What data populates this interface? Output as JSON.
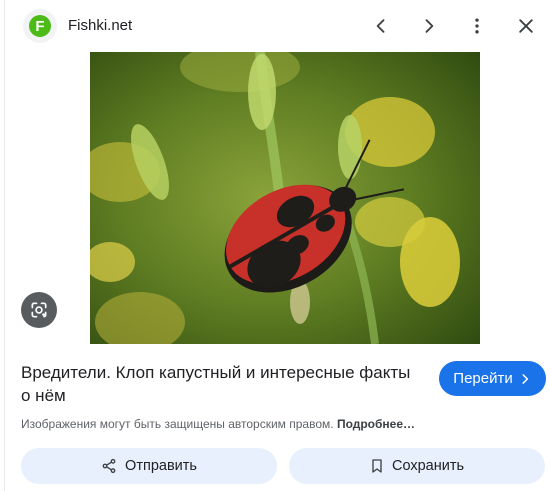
{
  "header": {
    "logo_letter": "F",
    "site_name": "Fishki.net",
    "icons": [
      "chevron-left-icon",
      "chevron-right-icon",
      "more-vert-icon",
      "close-icon"
    ]
  },
  "image": {
    "subject": "red-black shield bug on yellow flowers",
    "lens_icon": "lens-icon"
  },
  "result": {
    "title": "Вредители. Клоп капустный и интересные факты о нём",
    "go_label": "Перейти",
    "notice": "Изображения могут быть защищены авторским правом.",
    "more_label": "Подробнее…"
  },
  "actions": {
    "share_label": "Отправить",
    "save_label": "Сохранить"
  },
  "colors": {
    "accent": "#1a73e8",
    "action_bg": "#e8f0fe",
    "logo_green": "#4cbb17"
  }
}
